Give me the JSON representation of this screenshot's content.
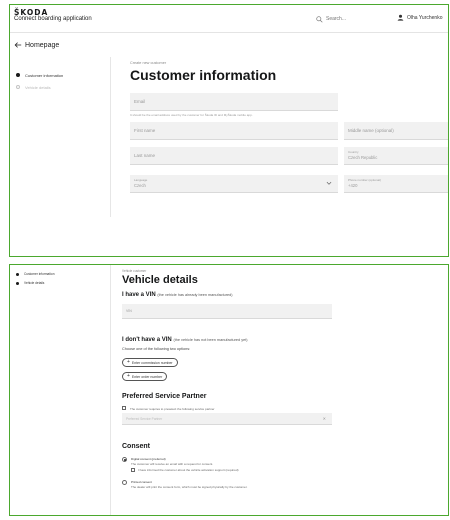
{
  "app": {
    "brand": "ŠKODA",
    "name": "Connect boarding application",
    "search_placeholder": "Search...",
    "user_name": "Olha Yurchenko"
  },
  "nav": {
    "back_label": "Homepage"
  },
  "steps": [
    {
      "label": "Customer information"
    },
    {
      "label": "Vehicle details"
    }
  ],
  "customer": {
    "breadcrumb": "Create new customer",
    "title": "Customer information",
    "email_label": "Email",
    "email_hint": "It should be the email address used by the customer for Škoda ID and MyŠkoda mobile app.",
    "first_name_label": "First name",
    "middle_name_label": "Middle name (optional)",
    "last_name_label": "Last name",
    "country_label": "Country",
    "country_value": "Czech Republic",
    "language_label": "Language",
    "language_value": "Czech",
    "phone_label": "Phone number (optional)",
    "phone_value": "+420"
  },
  "vehicle": {
    "breadcrumb": "Vehicle customer",
    "title": "Vehicle details",
    "have_vin_title": "I have a VIN",
    "have_vin_note": "(the vehicle has already been manufactured)",
    "vin_label": "VIN",
    "no_vin_title": "I don't have a VIN",
    "no_vin_note": "(the vehicle has not been manufactured yet)",
    "choose_text": "Choose one of the following two options:",
    "commission_button": "Enter commission number",
    "order_button": "Enter order number"
  },
  "partner": {
    "title": "Preferred Service Partner",
    "checkbox_label": "The customer requires to preselect the following service partner",
    "input_placeholder": "Preferred Service Partner"
  },
  "consent": {
    "title": "Consent",
    "digital_label": "Digital consent (preferred)",
    "digital_desc": "The customer will receive an email with a request for consent.",
    "digital_check": "I have informed the customer about the vehicle activation support (required)",
    "printed_label": "Printed consent",
    "printed_desc": "The dealer will print the consent form, which must be signed physically by the customer."
  }
}
